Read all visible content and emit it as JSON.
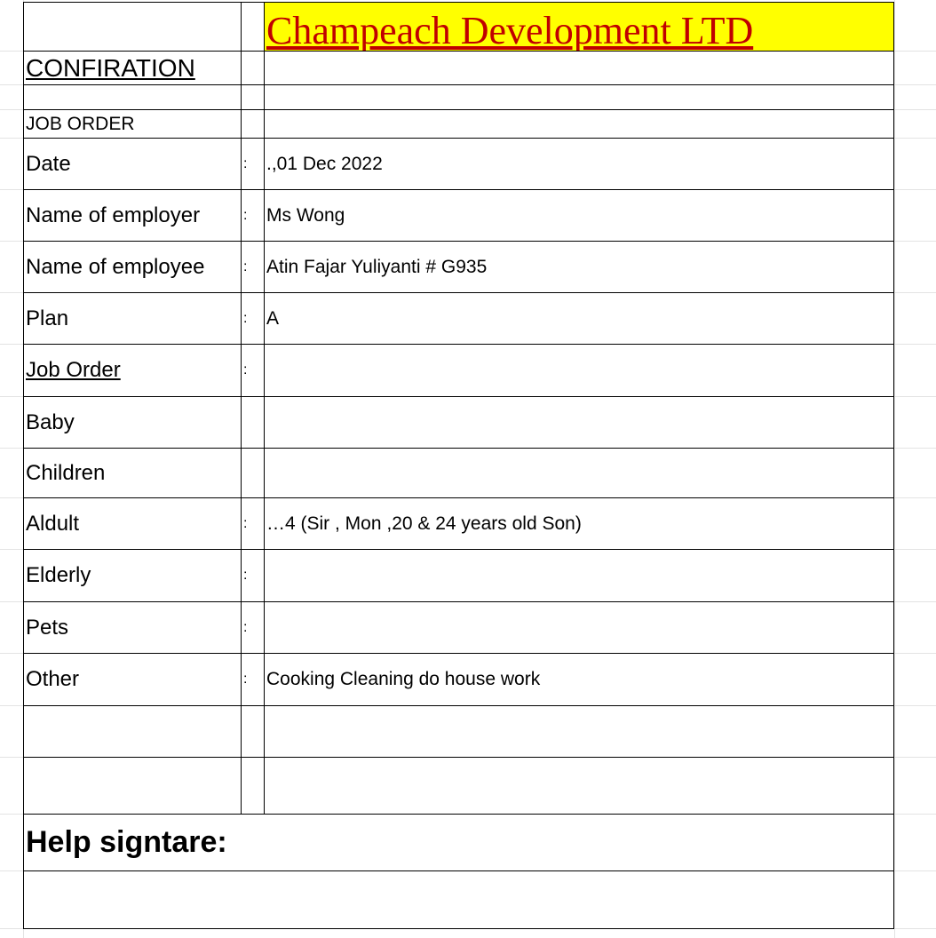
{
  "company": {
    "name": "Champeach Development LTD"
  },
  "heading": "CONFIRATION",
  "section_label": "JOB ORDER",
  "separator": ":",
  "fields": {
    "date": {
      "label": "Date",
      "value": ".,01 Dec 2022"
    },
    "employer": {
      "label": "Name of employer",
      "value": "Ms Wong"
    },
    "employee": {
      "label": "Name of employee",
      "value": "Atin Fajar Yuliyanti # G935"
    },
    "plan": {
      "label": "Plan",
      "value": "A"
    },
    "job_order": {
      "label": "Job Order",
      "value": ""
    },
    "baby": {
      "label": "Baby",
      "value": ""
    },
    "children": {
      "label": "Children",
      "value": ""
    },
    "adult": {
      "label": "Aldult",
      "value": "…4 (Sir , Mon ,20 & 24 years old Son)"
    },
    "elderly": {
      "label": "Elderly",
      "value": ""
    },
    "pets": {
      "label": "Pets",
      "value": ""
    },
    "other": {
      "label": "Other",
      "value": "Cooking Cleaning do house work"
    }
  },
  "signature": {
    "label": "Help signtare:"
  }
}
